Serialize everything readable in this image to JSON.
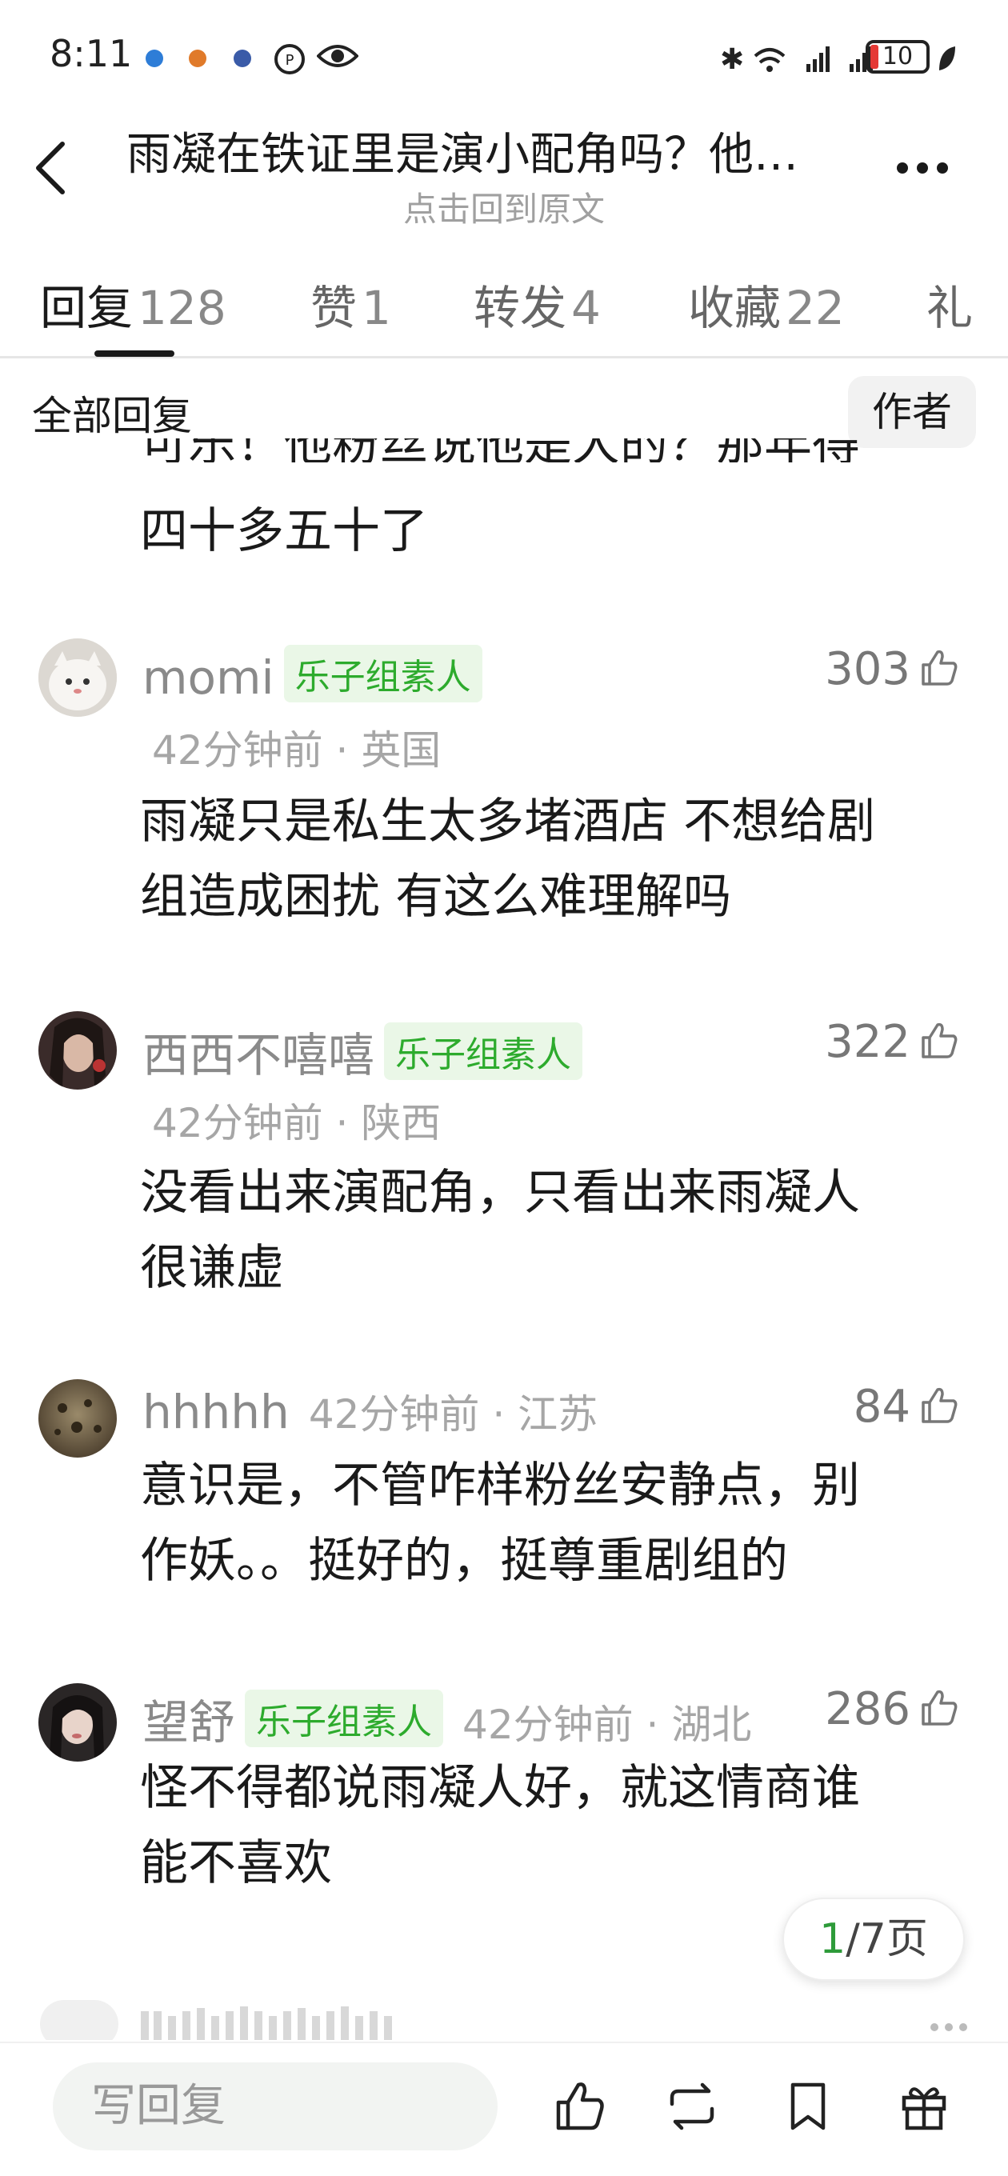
{
  "status_bar": {
    "time": "8:11",
    "battery": "10",
    "dot_colors": [
      "#2e7dd7",
      "#e07a2a",
      "#3a5ba8"
    ]
  },
  "header": {
    "title": "雨凝在铁证里是演小配角吗？他…",
    "subtitle": "点击回到原文",
    "back_icon": "chevron-left-icon",
    "more_icon": "more-dots-icon"
  },
  "tabs": [
    {
      "label": "回复",
      "count": "128"
    },
    {
      "label": "赞",
      "count": "1"
    },
    {
      "label": "转发",
      "count": "4"
    },
    {
      "label": "收藏",
      "count": "22"
    },
    {
      "label": "礼",
      "count": ""
    }
  ],
  "filter": {
    "label": "全部回复",
    "author_chip": "作者"
  },
  "partial_comment": {
    "line": "四十多五十了",
    "clipped_line": "可乐！他粉丝说他是大的？那年得"
  },
  "comments": [
    {
      "name": "momi",
      "badge": "乐子组素人",
      "time": "42分钟前",
      "location": "英国",
      "likes": "303",
      "text_lines": [
        "雨凝只是私生太多堵酒店 不想给剧",
        "组造成困扰 有这么难理解吗"
      ]
    },
    {
      "name": "西西不嘻嘻",
      "badge": "乐子组素人",
      "time": "42分钟前",
      "location": "陕西",
      "likes": "322",
      "text_lines": [
        "没看出来演配角，只看出来雨凝人",
        "很谦虚"
      ]
    },
    {
      "name": "hhhhh",
      "badge": "",
      "time": "42分钟前",
      "location": "江苏",
      "likes": "84",
      "text_lines": [
        "意识是，不管咋样粉丝安静点，别",
        "作妖。。挺好的，挺尊重剧组的"
      ]
    },
    {
      "name": "望舒",
      "badge": "乐子组素人",
      "time": "42分钟前",
      "location": "湖北",
      "likes": "286",
      "text_lines": [
        "怪不得都说雨凝人好，就这情商谁",
        "能不喜欢"
      ]
    }
  ],
  "pager": {
    "current": "1",
    "total_text": "/7页"
  },
  "bottom_bar": {
    "reply_placeholder": "写回复",
    "icons": [
      "thumbs-up-icon",
      "repost-icon",
      "bookmark-icon",
      "gift-icon"
    ]
  },
  "colors": {
    "badge_green": "#2dab2d",
    "badge_bg": "#eaf7e7",
    "page_green": "#2e9b3a"
  }
}
